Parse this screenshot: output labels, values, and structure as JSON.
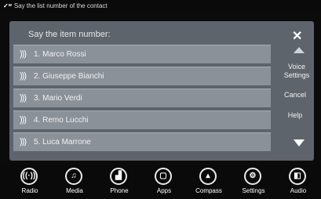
{
  "status": {
    "text": "Say the list number of the contact"
  },
  "dialog": {
    "prompt": "Say the item number:",
    "items": [
      {
        "label": "1. Marco Rossi"
      },
      {
        "label": "2. Giuseppe Bianchi"
      },
      {
        "label": "3. Mario Verdi"
      },
      {
        "label": "4. Remo Lucchi"
      },
      {
        "label": "5. Luca Marrone"
      }
    ]
  },
  "side": {
    "voice_settings": "Voice Settings",
    "cancel": "Cancel",
    "help": "Help"
  },
  "nav": {
    "items": [
      {
        "label": "Radio",
        "icon": "radio-icon"
      },
      {
        "label": "Media",
        "icon": "media-icon"
      },
      {
        "label": "Phone",
        "icon": "phone-icon"
      },
      {
        "label": "Apps",
        "icon": "apps-icon"
      },
      {
        "label": "Compass",
        "icon": "compass-icon"
      },
      {
        "label": "Settings",
        "icon": "settings-icon"
      },
      {
        "label": "Audio",
        "icon": "audio-icon"
      }
    ]
  }
}
